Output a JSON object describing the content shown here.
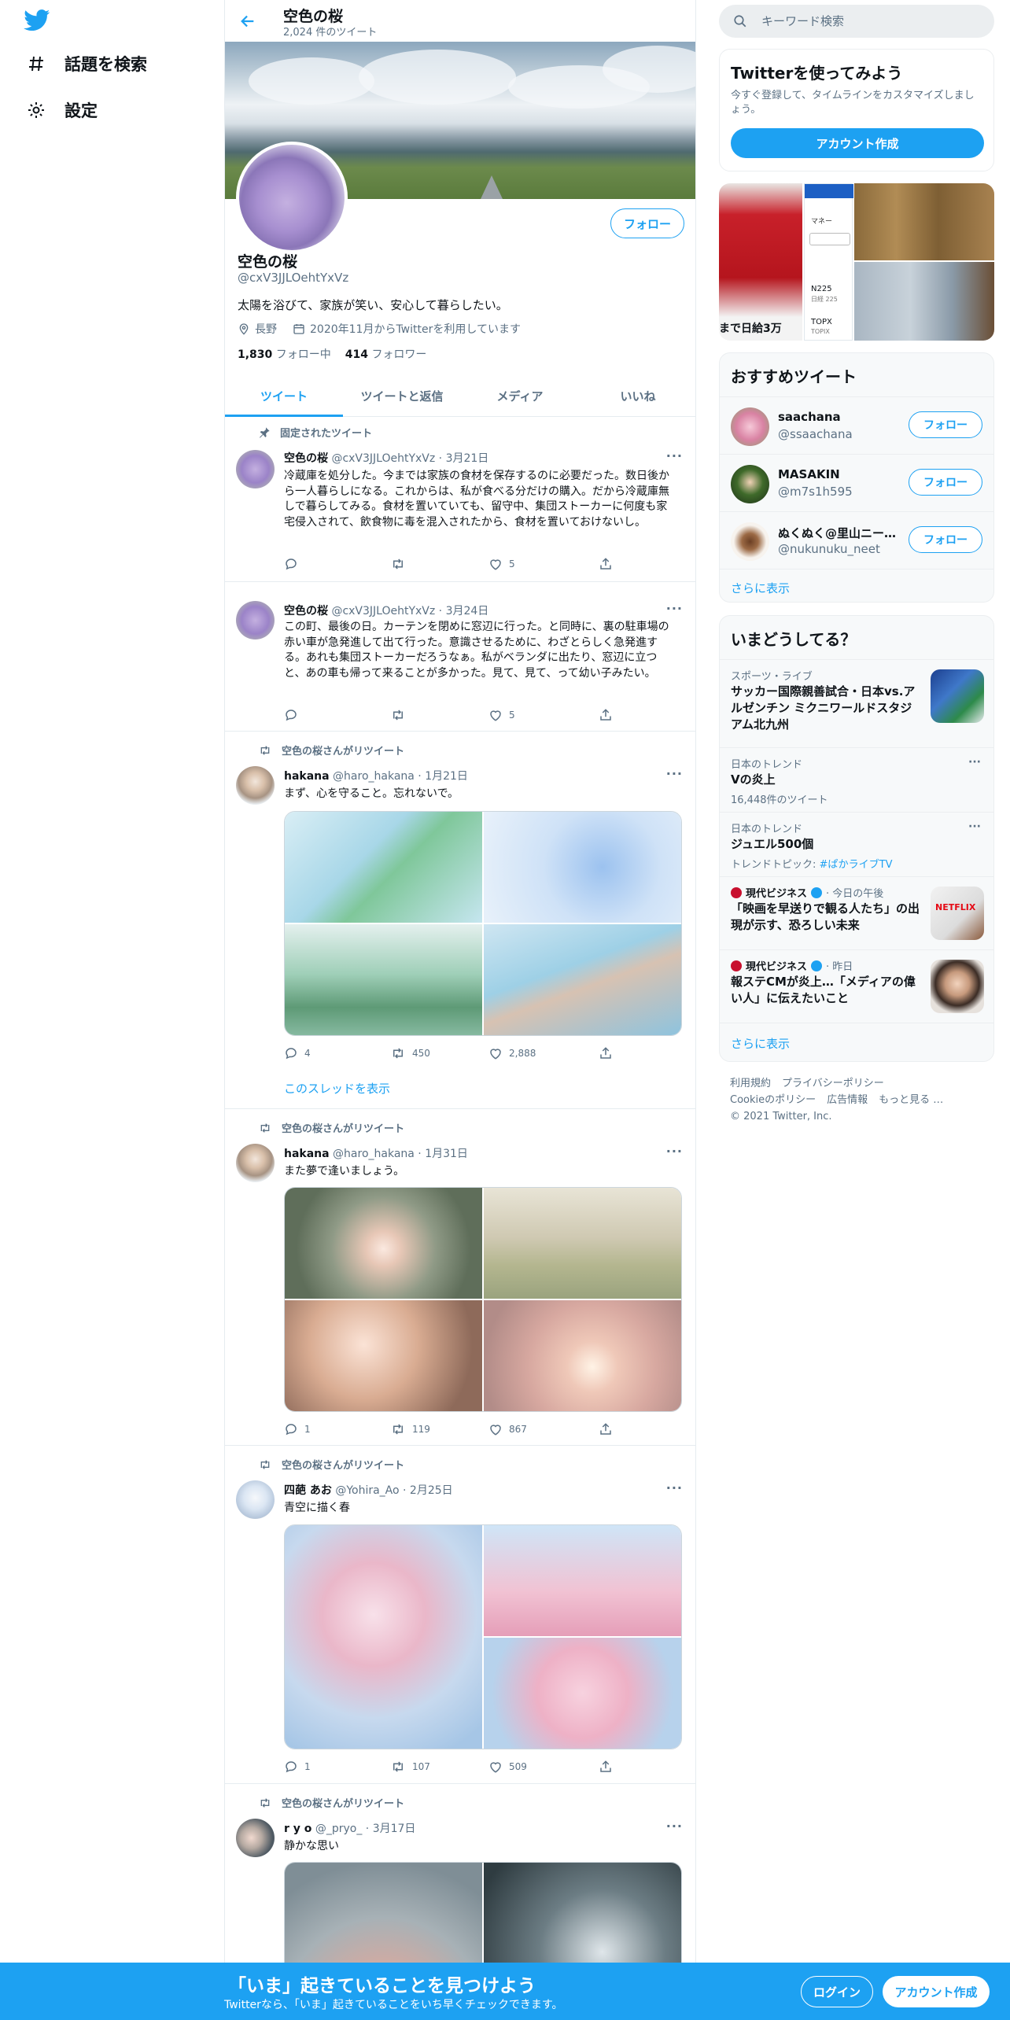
{
  "nav": {
    "explore_label": "話題を検索",
    "settings_label": "設定"
  },
  "header": {
    "title": "空色の桜",
    "subtitle": "2,024 件のツイート"
  },
  "profile": {
    "name": "空色の桜",
    "handle": "@cxV3JJLOehtYxVz",
    "bio": "太陽を浴びて、家族が笑い、安心して暮らしたい。",
    "location": "長野",
    "joined": "2020年11月からTwitterを利用しています",
    "following_count": "1,830",
    "following_label": "フォロー中",
    "followers_count": "414",
    "followers_label": "フォロワー",
    "follow_button": "フォロー"
  },
  "tabs": [
    "ツイート",
    "ツイートと返信",
    "メディア",
    "いいね"
  ],
  "tweets": [
    {
      "context": "固定されたツイート",
      "name": "空色の桜",
      "meta": "@cxV3JJLOehtYxVz · 3月21日",
      "text": "冷蔵庫を処分した。今までは家族の食材を保存するのに必要だった。数日後から一人暮らしになる。これからは、私が食べる分だけの購入。だから冷蔵庫無しで暮らしてみる。食材を置いていても、留守中、集団ストーカーに何度も家宅侵入されて、飲食物に毒を混入されたから、食材を置いておけないし。",
      "reply": "",
      "retweet": "",
      "like": "5"
    },
    {
      "context": "",
      "name": "空色の桜",
      "meta": "@cxV3JJLOehtYxVz · 3月24日",
      "text": "この町、最後の日。カーテンを閉めに窓辺に行った。と同時に、裏の駐車場の赤い車が急発進して出て行った。意識させるために、わざとらしく急発進する。あれも集団ストーカーだろうなぁ。私がベランダに出たり、窓辺に立つと、あの車も帰って来ることが多かった。見て、見て、って幼い子みたい。",
      "reply": "",
      "retweet": "",
      "like": "5"
    },
    {
      "context": "空色の桜さんがリツイート",
      "name": "hakana",
      "meta": "@haro_hakana · 1月21日",
      "text": "まず、心を守ること。忘れないで。",
      "reply": "4",
      "retweet": "450",
      "like": "2,888",
      "show_thread": "このスレッドを表示"
    },
    {
      "context": "空色の桜さんがリツイート",
      "name": "hakana",
      "meta": "@haro_hakana · 1月31日",
      "text": "また夢で逢いましょう。",
      "reply": "1",
      "retweet": "119",
      "like": "867"
    },
    {
      "context": "空色の桜さんがリツイート",
      "name": "四葩 あお",
      "meta": "@Yohira_Ao · 2月25日",
      "text": "青空に描く春",
      "reply": "1",
      "retweet": "107",
      "like": "509"
    },
    {
      "context": "空色の桜さんがリツイート",
      "name": "r y o",
      "meta": "@_pryo_ · 3月17日",
      "text": "静かな思い"
    }
  ],
  "right": {
    "search_placeholder": "キーワード検索",
    "signup_card": {
      "title": "Twitterを使ってみよう",
      "desc": "今すぐ登録して、タイムラインをカスタマイズしましょう。",
      "button": "アカウント作成"
    },
    "media_text": {
      "caption": "まで日給3万",
      "menu": "マネー",
      "n225": "N225",
      "n225_sub": "日経 225",
      "topx": "TOPX",
      "topx_sub": "TOPIX"
    },
    "recommended": {
      "title": "おすすめツイート",
      "users": [
        {
          "name": "saachana",
          "handle": "@ssaachana"
        },
        {
          "name": "MASAKIN",
          "handle": "@m7s1h595"
        },
        {
          "name": "ぬくぬく@里山ニー…",
          "handle": "@nukunuku_neet"
        }
      ],
      "follow_label": "フォロー",
      "show_more": "さらに表示"
    },
    "trends": {
      "title": "いまどうしてる？",
      "items": [
        {
          "category": "スポーツ・ライブ",
          "headline": "サッカー国際親善試合・日本vs.アルゼンチン ミクニワールドスタジアム北九州"
        },
        {
          "category": "日本のトレンド",
          "headline": "Vの炎上",
          "sub": "16,448件のツイート"
        },
        {
          "category": "日本のトレンド",
          "headline": "ジュエル500個",
          "sub_prefix": "トレンドトピック: ",
          "sub_link": "#ぱかライブTV"
        },
        {
          "category": "現代ビジネス",
          "category_suffix": " · 今日の午後",
          "headline": "「映画を早送りで観る人たち」の出現が示す、恐ろしい未来",
          "thumb_text": "NETFLIX"
        },
        {
          "category": "現代ビジネス",
          "category_suffix": " · 昨日",
          "headline": "報ステCMが炎上…「メディアの偉い人」に伝えたいこと"
        }
      ],
      "show_more": "さらに表示"
    },
    "footer": {
      "links": [
        "利用規約",
        "プライバシーポリシー",
        "Cookieのポリシー",
        "広告情報",
        "もっと見る …"
      ],
      "copyright": "© 2021 Twitter, Inc."
    }
  },
  "bottom_bar": {
    "headline": "「いま」起きていることを見つけよう",
    "sub": "Twitterなら、「いま」起きていることをいち早くチェックできます。",
    "login": "ログイン",
    "signup": "アカウント作成"
  },
  "colors": {
    "accent": "#1da1f2",
    "text": "#0f1419",
    "muted": "#5b7083",
    "like": "#e0245e",
    "retweet": "#17bf63"
  }
}
